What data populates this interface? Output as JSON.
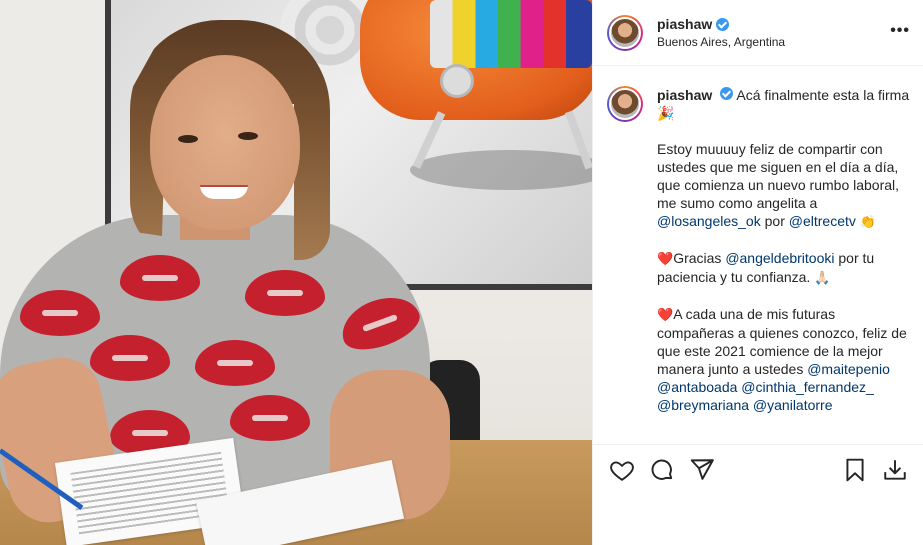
{
  "post": {
    "username": "piashaw",
    "location": "Buenos Aires, Argentina",
    "more_label": "•••",
    "caption": {
      "intro": "Acá finalmente esta la firma 🎉",
      "p1_text": "Estoy muuuuy feliz de compartir con ustedes que me siguen en el día a día, que comienza un nuevo rumbo laboral, me sumo como angelita a",
      "p1_mention1": "@losangeles_ok",
      "p1_mid": "por",
      "p1_mention2": "@eltrecetv",
      "p1_emoji": "👏",
      "p2_heart": "❤️",
      "p2_prefix": "Gracias",
      "p2_mention": "@angeldebritooki",
      "p2_text": "por tu paciencia y tu confianza.",
      "p2_emoji": "🙏🏻",
      "p3_heart": "❤️",
      "p3_text": "A cada una de mis futuras compañeras a quienes conozco, feliz de que este 2021 comience de la mejor manera junto a ustedes",
      "p3_mentions": [
        "@maitepenio",
        "@antaboada",
        "@cinthia_fernandez_",
        "@breymariana",
        "@yanilatorre"
      ]
    }
  },
  "icons": {
    "like": "heart-icon",
    "comment": "comment-icon",
    "share": "send-icon",
    "save": "bookmark-icon",
    "download": "download-icon"
  },
  "colors": {
    "verified": "#3897f0",
    "mention": "#00376b",
    "text": "#262626",
    "divider": "#efefef"
  }
}
